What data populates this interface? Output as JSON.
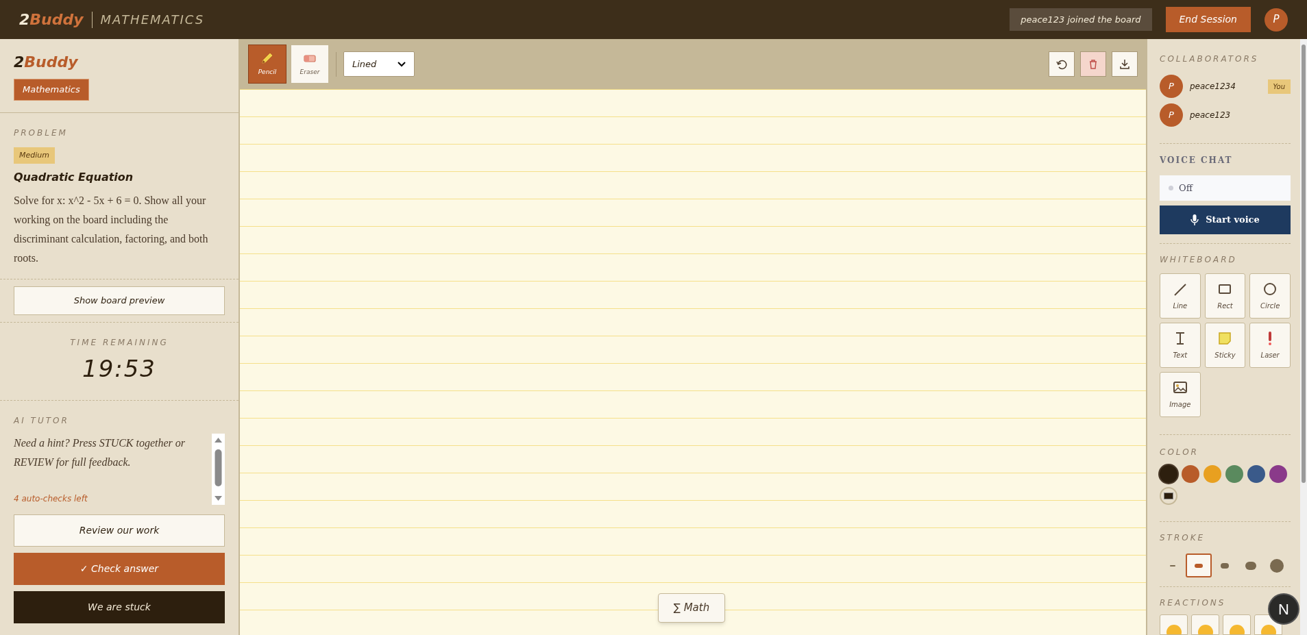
{
  "header": {
    "brand_prefix": "2",
    "brand_name": "Buddy",
    "subject": "MATHEMATICS",
    "notice": "peace123 joined the board",
    "end_button": "End Session",
    "avatar": "P"
  },
  "left": {
    "logo_prefix": "2",
    "logo_name": "Buddy",
    "subject_badge": "Mathematics",
    "problem": {
      "heading": "PROBLEM",
      "difficulty": "Medium",
      "title": "Quadratic Equation",
      "description": "Solve for x: x^2 - 5x + 6 = 0. Show all your working on the board including the discriminant calculation, factoring, and both roots."
    },
    "preview_button": "Show board preview",
    "timer": {
      "label": "TIME REMAINING",
      "value": "19:53"
    },
    "ai_tutor": {
      "heading": "AI TUTOR",
      "message": "Need a hint? Press STUCK together or REVIEW for full feedback.",
      "checks_left": "4 auto-checks left"
    },
    "buttons": [
      {
        "label": "Review our work",
        "kind": "outline"
      },
      {
        "label": "✓ Check answer",
        "kind": "accent"
      },
      {
        "label": "We are stuck",
        "kind": "dark"
      }
    ]
  },
  "toolbar": {
    "tools": [
      {
        "label": "Pencil",
        "kind": "pencil",
        "selected": true
      },
      {
        "label": "Eraser",
        "kind": "eraser",
        "selected": false
      }
    ],
    "paper": "Lined",
    "actions": [
      {
        "kind": "undo"
      },
      {
        "kind": "clear"
      },
      {
        "kind": "download"
      }
    ]
  },
  "canvas": {
    "math_button": "∑ Math"
  },
  "right": {
    "collaborators": {
      "heading": "COLLABORATORS",
      "people": [
        {
          "initial": "P",
          "name": "peace1234",
          "badge": "You"
        },
        {
          "initial": "P",
          "name": "peace123"
        }
      ]
    },
    "voice": {
      "heading": "VOICE CHAT",
      "status": "Off",
      "on": false,
      "button": "Start voice"
    },
    "whiteboard": {
      "heading": "WHITEBOARD",
      "shapes": [
        {
          "label": "Line",
          "kind": "line"
        },
        {
          "label": "Rect",
          "kind": "rect"
        },
        {
          "label": "Circle",
          "kind": "circle"
        },
        {
          "label": "Text",
          "kind": "text"
        },
        {
          "label": "Sticky",
          "kind": "sticky"
        },
        {
          "label": "Laser",
          "kind": "laser"
        },
        {
          "label": "Image",
          "kind": "image"
        }
      ]
    },
    "color": {
      "heading": "COLOR",
      "swatches": [
        {
          "color": "#2d1f0e",
          "selected": true
        },
        {
          "color": "#b85c2a",
          "selected": false
        },
        {
          "color": "#e8a020",
          "selected": false
        },
        {
          "color": "#5a8a5e",
          "selected": false
        },
        {
          "color": "#3a5a8a",
          "selected": false
        },
        {
          "color": "#8a3a8a",
          "selected": false
        }
      ]
    },
    "stroke": {
      "heading": "STROKE",
      "sizes": [
        {
          "kind": "xs",
          "selected": false
        },
        {
          "kind": "s",
          "selected": true
        },
        {
          "kind": "m",
          "selected": false
        },
        {
          "kind": "l",
          "selected": false
        },
        {
          "kind": "xl",
          "selected": false
        }
      ]
    },
    "reactions": {
      "heading": "REACTIONS",
      "items": [
        {
          "kind": "emoji"
        },
        {
          "kind": "emoji"
        },
        {
          "kind": "emoji"
        },
        {
          "kind": "emoji"
        }
      ]
    }
  },
  "dev_badge": "N"
}
